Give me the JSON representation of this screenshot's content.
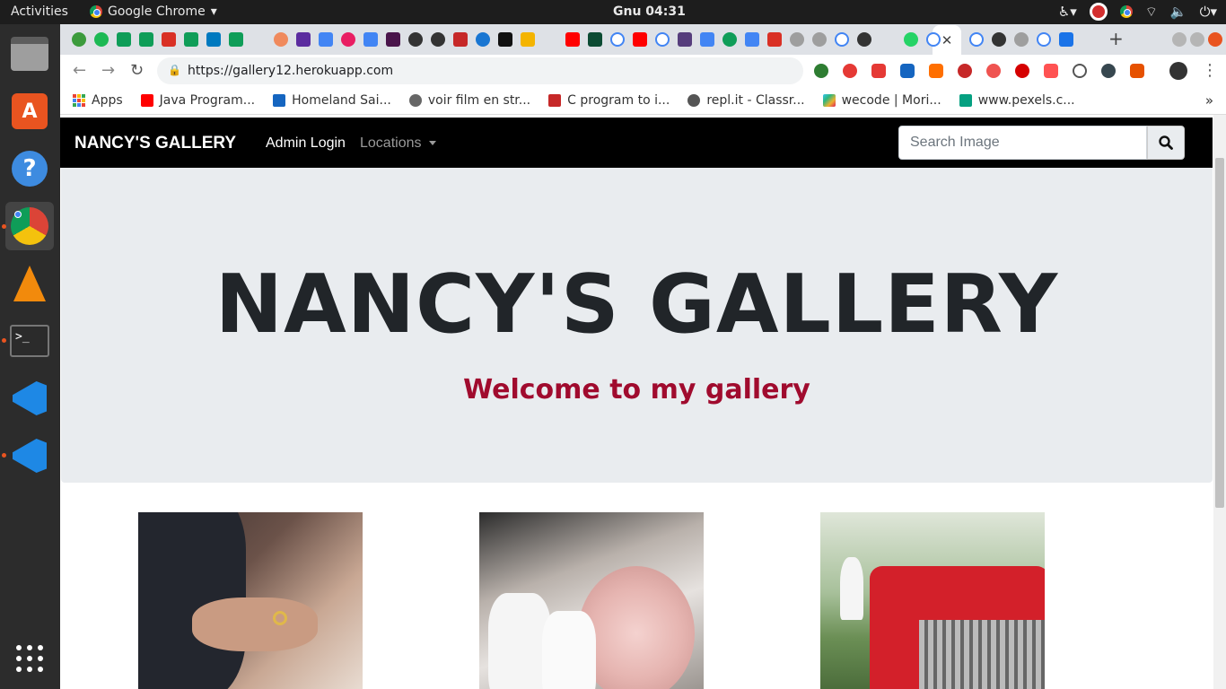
{
  "system_bar": {
    "activities": "Activities",
    "app_name": "Google Chrome",
    "clock": "Gnu 04:31"
  },
  "browser": {
    "url": "https://gallery12.herokuapp.com",
    "bookmarks": [
      {
        "label": "Apps"
      },
      {
        "label": "Java Program..."
      },
      {
        "label": "Homeland Sai..."
      },
      {
        "label": "voir film en str..."
      },
      {
        "label": "C program to i..."
      },
      {
        "label": "repl.it - Classr..."
      },
      {
        "label": "wecode | Mori..."
      },
      {
        "label": "www.pexels.c..."
      }
    ],
    "more_bookmarks": "»"
  },
  "site": {
    "brand": "NANCY'S GALLERY",
    "nav": {
      "admin_login": "Admin Login",
      "locations": "Locations"
    },
    "search_placeholder": "Search Image",
    "hero_title": "NANCY'S GALLERY",
    "hero_subtitle": "Welcome to my gallery"
  },
  "colors": {
    "navbar_bg": "#000000",
    "jumbotron_bg": "#e9ecef",
    "subtitle": "#a00b2e"
  }
}
